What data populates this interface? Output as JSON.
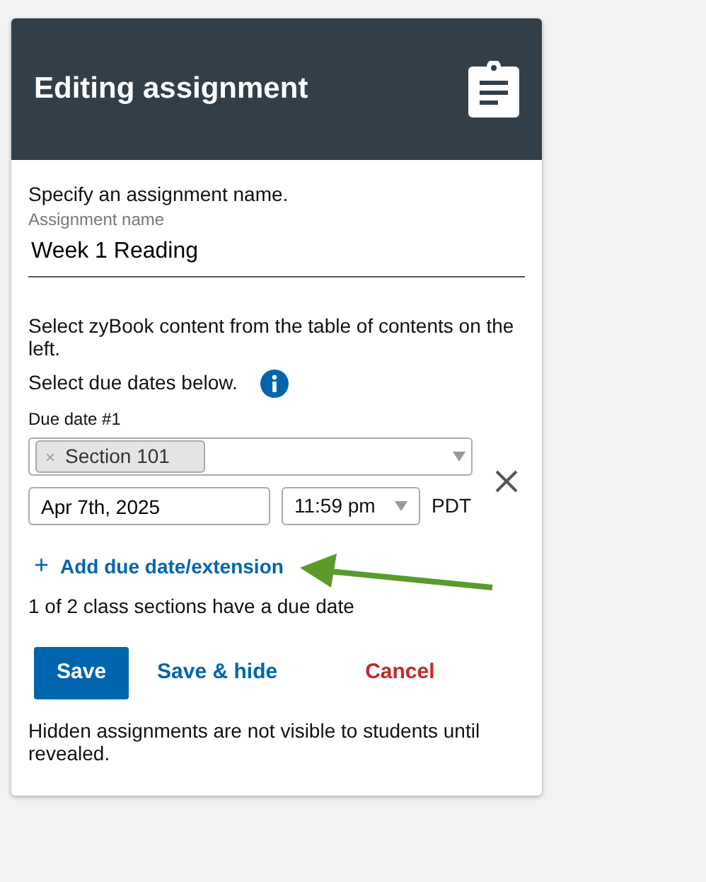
{
  "header": {
    "title": "Editing assignment"
  },
  "name_prompt": "Specify an assignment name.",
  "name_field": {
    "label": "Assignment name",
    "value": "Week 1 Reading"
  },
  "content_note": "Select zyBook content from the table of contents on the left.",
  "due_dates_prompt": "Select due dates below.",
  "due_dates": [
    {
      "label": "Due date #1",
      "sections": [
        {
          "remove": "×",
          "label": "Section 101"
        }
      ],
      "date": "Apr 7th, 2025",
      "time": "11:59 pm",
      "timezone": "PDT"
    }
  ],
  "add_link": {
    "icon": "+",
    "label": "Add due date/extension"
  },
  "status": "1 of 2 class sections have a due date",
  "buttons": [
    {
      "kind": "primary",
      "label": "Save"
    },
    {
      "kind": "link",
      "label": "Save & hide"
    },
    {
      "kind": "danger",
      "label": "Cancel"
    }
  ],
  "hidden_note": "Hidden assignments are not visible to students until revealed."
}
